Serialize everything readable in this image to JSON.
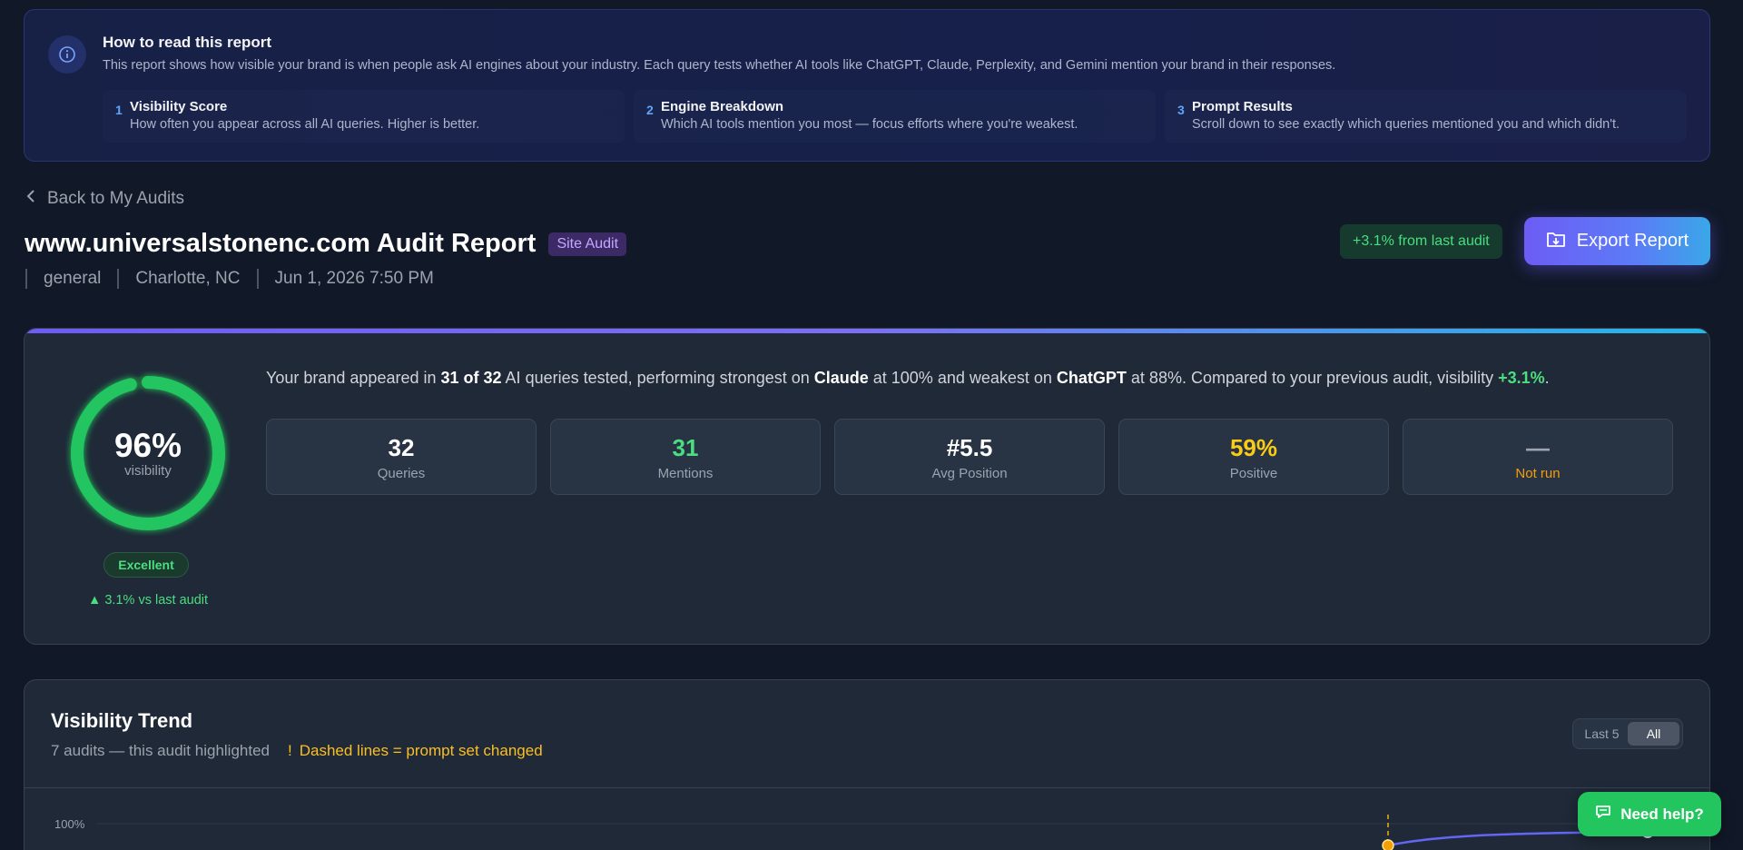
{
  "banner": {
    "title": "How to read this report",
    "description": "This report shows how visible your brand is when people ask AI engines about your industry. Each query tests whether AI tools like ChatGPT, Claude, Perplexity, and Gemini mention your brand in their responses.",
    "icon": "info-icon",
    "steps": [
      {
        "num": "1",
        "title": "Visibility Score",
        "desc": "How often you appear across all AI queries. Higher is better."
      },
      {
        "num": "2",
        "title": "Engine Breakdown",
        "desc": "Which AI tools mention you most — focus efforts where you're weakest."
      },
      {
        "num": "3",
        "title": "Prompt Results",
        "desc": "Scroll down to see exactly which queries mentioned you and which didn't."
      }
    ]
  },
  "nav": {
    "back_label": "Back to My Audits"
  },
  "header": {
    "title": "www.universalstonenc.com Audit Report",
    "type_badge": "Site Audit",
    "meta": [
      "general",
      "Charlotte, NC",
      "Jun 1, 2026 7:50 PM"
    ],
    "delta_pill": "+3.1% from last audit",
    "export_label": "Export Report"
  },
  "summary": {
    "visibility_pct": "96%",
    "visibility_value": 0.96,
    "visibility_label": "visibility",
    "grade": "Excellent",
    "vs_last": "▲ 3.1% vs last audit",
    "text": {
      "t1": "Your brand appeared in ",
      "b1": "31 of 32",
      "t2": " AI queries tested, performing strongest on ",
      "b2": "Claude",
      "t3": " at 100% and weakest on ",
      "b3": "ChatGPT",
      "t4": " at 88%. Compared to your previous audit, visibility ",
      "delta": "+3.1%",
      "t5": "."
    },
    "stats": [
      {
        "value": "32",
        "label": "Queries"
      },
      {
        "value": "31",
        "label": "Mentions"
      },
      {
        "value": "#5.5",
        "label": "Avg Position"
      },
      {
        "value": "59%",
        "label": "Positive"
      },
      {
        "value": "—",
        "label": "Not run"
      }
    ]
  },
  "trend": {
    "title": "Visibility Trend",
    "subtitle": "7 audits — this audit highlighted",
    "warning_icon": "!",
    "warning": "Dashed lines = prompt set changed",
    "toggle": [
      "Last 5",
      "All"
    ],
    "y_top_label": "100%"
  },
  "help": {
    "label": "Need help?"
  },
  "colors": {
    "accent": "#6d5cf5",
    "success": "#4ade80",
    "warning": "#facc15",
    "background": "#111827",
    "card": "#1f2937"
  }
}
